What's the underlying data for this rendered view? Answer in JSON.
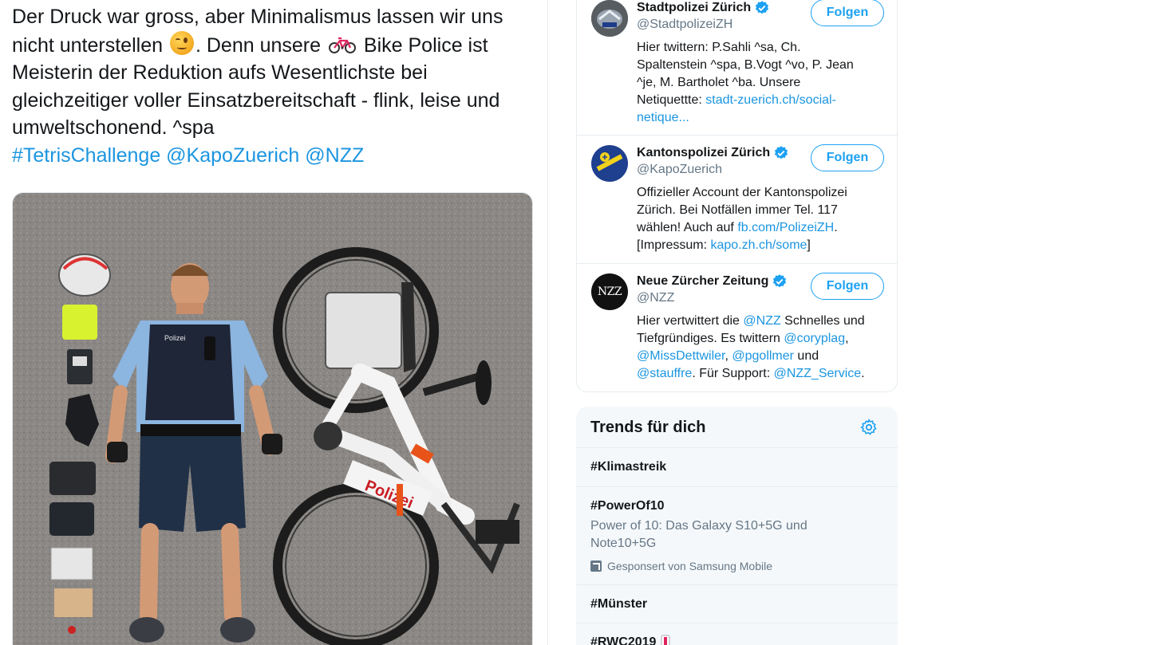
{
  "tweet": {
    "lines": [
      "Der Druck war gross, aber Minimalismus lassen wir uns",
      "nicht unterstellen",
      ". Denn unsere",
      "Bike Police ist",
      "Meisterin der Reduktion aufs Wesentlichste bei",
      "gleichzeitiger voller Einsatzbereitschaft - flink, leise und",
      "umweltschonend.  ^spa"
    ],
    "hashtags": [
      "#TetrisChallenge",
      "@KapoZuerich",
      "@NZZ"
    ],
    "emojis": [
      "winking-face",
      "bicycle"
    ],
    "photo": {
      "bike_lettering": "Polizei",
      "vest_lettering": "Polizei"
    }
  },
  "who_to_follow": [
    {
      "name": "Stadtpolizei Zürich",
      "handle": "@StadtpolizeiZH",
      "verified": true,
      "follow_label": "Folgen",
      "bio_lines": [
        [
          "Hier twittern: P.Sahli ^sa, Ch."
        ],
        [
          "Spaltenstein ^spa, B.Vogt ^vo, P. Jean"
        ],
        [
          "^je, M. Bartholet ^ba. Unsere"
        ],
        [
          "Netiquettte: ",
          "stadt-zuerich.ch/social-"
        ],
        [
          "",
          "netique..."
        ]
      ]
    },
    {
      "name": "Kantonspolizei Zürich",
      "handle": "@KapoZuerich",
      "verified": true,
      "follow_label": "Folgen",
      "bio_lines": [
        [
          "Offizieller Account der Kantonspolizei"
        ],
        [
          "Zürich. Bei Notfällen immer Tel. 117"
        ],
        [
          "wählen! Auch auf ",
          "fb.com/PolizeiZH",
          "."
        ],
        [
          "[Impressum: ",
          "kapo.zh.ch/some",
          "]"
        ]
      ]
    },
    {
      "name": "Neue Zürcher Zeitung",
      "handle": "@NZZ",
      "verified": true,
      "follow_label": "Folgen",
      "avatar_text": "NZZ",
      "bio_lines": [
        [
          "Hier vertwittert die ",
          "@NZZ",
          " Schnelles und"
        ],
        [
          "Tiefgründiges. Es twittern ",
          "@coryplag",
          ","
        ],
        [
          "",
          "@MissDettwiler",
          ", ",
          "@pgollmer",
          " und"
        ],
        [
          "",
          "@stauffre",
          ". Für Support: ",
          "@NZZ_Service",
          "."
        ]
      ]
    }
  ],
  "trends": {
    "title": "Trends für dich",
    "settings_icon": "gear-icon",
    "items": [
      {
        "name": "#Klimastreik"
      },
      {
        "name": "#PowerOf10",
        "description_lines": [
          "Power of 10: Das Galaxy S10+5G und",
          "Note10+5G"
        ],
        "promoted": "Gesponsert von Samsung Mobile"
      },
      {
        "name": "#Münster"
      },
      {
        "name": "#RWC2019"
      }
    ]
  },
  "colors": {
    "link": "#1b95e0",
    "accent": "#1da1f2",
    "text": "#14171a",
    "secondary_text": "#657786",
    "trends_bg": "#f5f8fa",
    "border": "#e6ecf0"
  }
}
